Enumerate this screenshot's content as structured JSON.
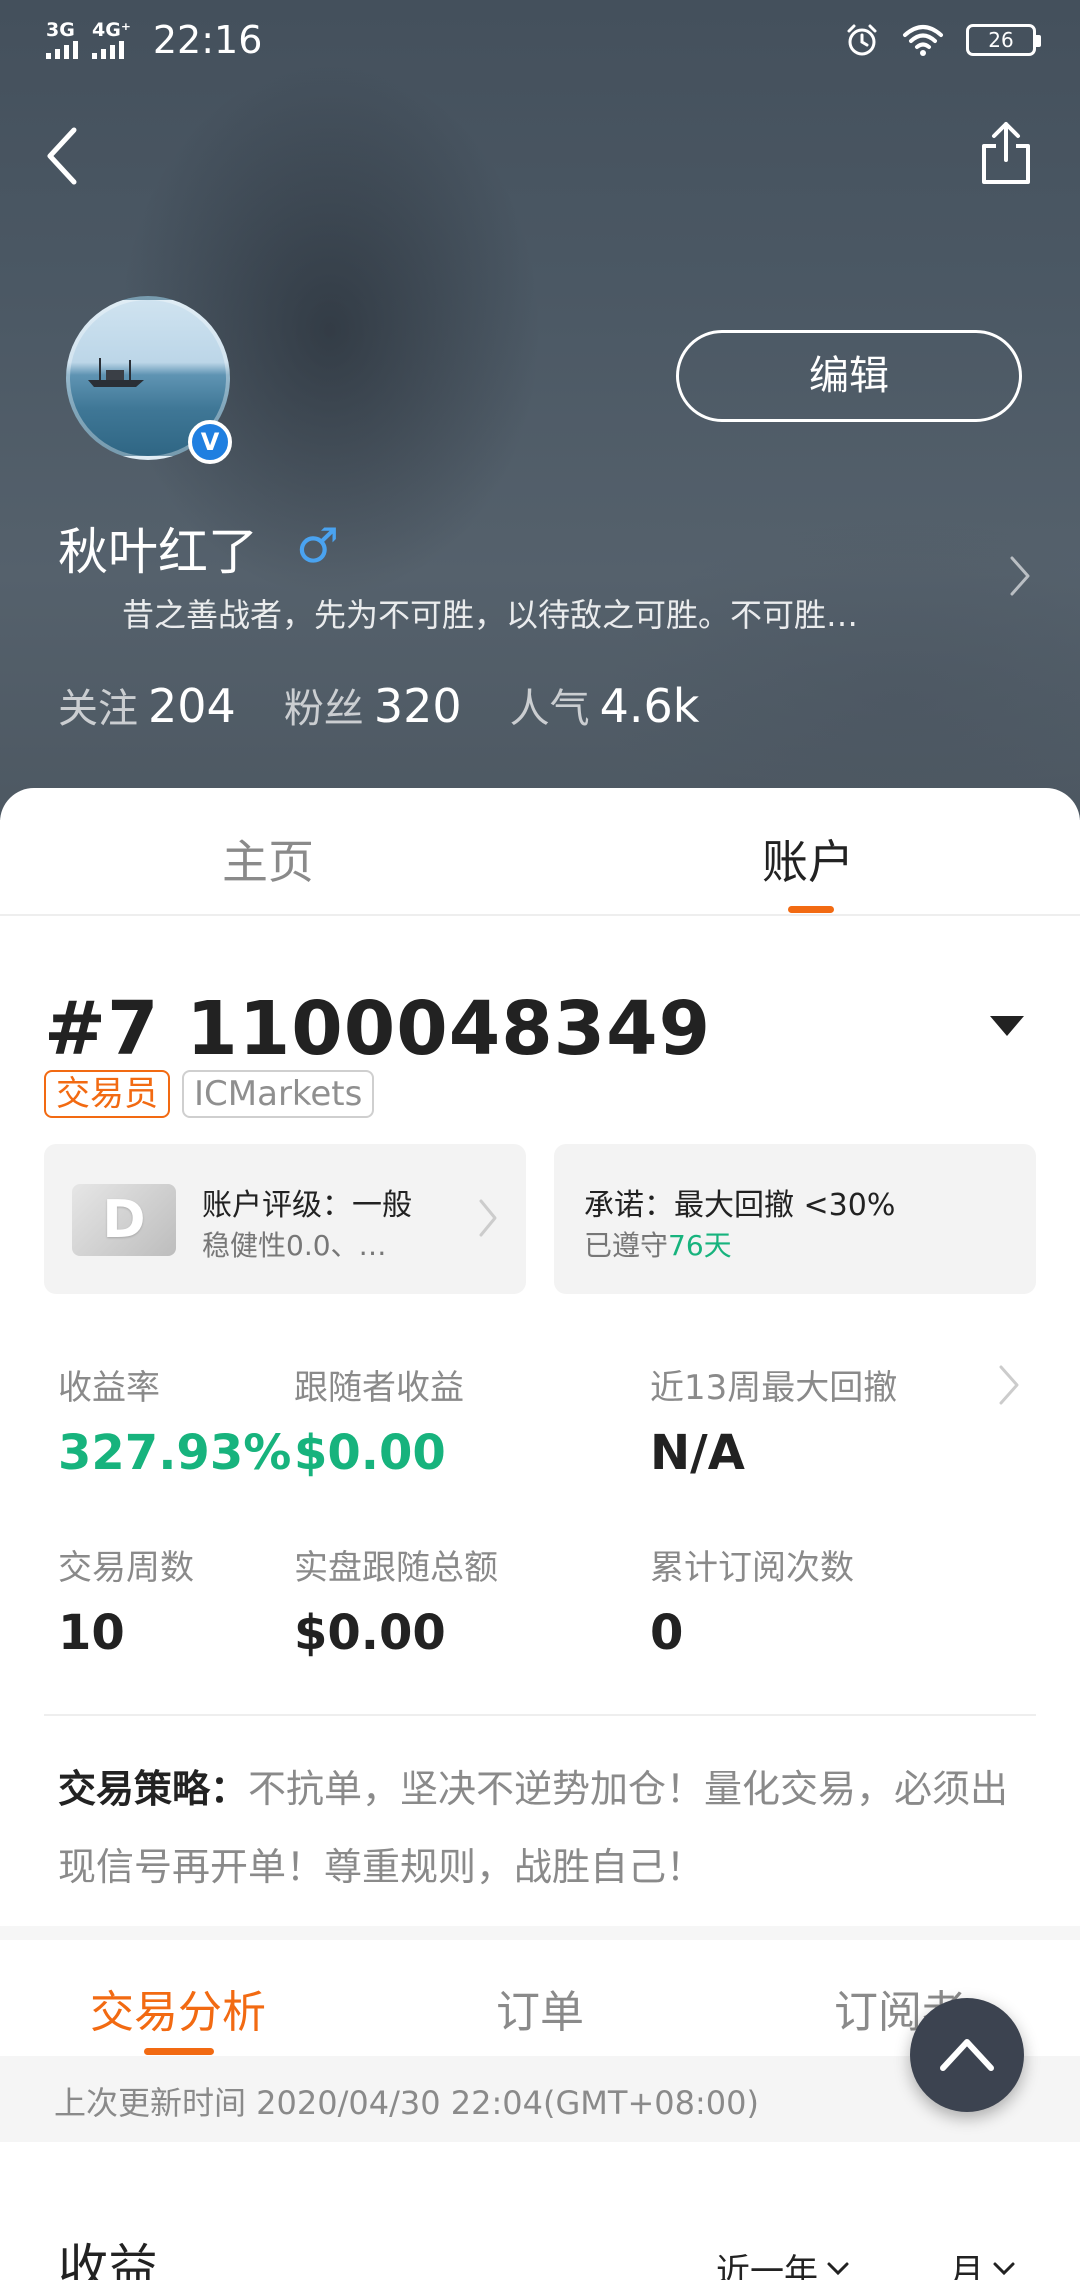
{
  "status_bar": {
    "net1": "3G",
    "net2": "4G⁺",
    "time": "22:16",
    "battery": "26"
  },
  "header": {
    "edit_label": "编辑",
    "user_name": "秋叶红了",
    "gender_symbol": "♂",
    "verify_symbol": "V",
    "bio": "昔之善战者，先为不可胜，以待敌之可胜。不可胜…",
    "stats": [
      {
        "label": "关注",
        "value": "204"
      },
      {
        "label": "粉丝",
        "value": "320"
      },
      {
        "label": "人气",
        "value": "4.6k"
      }
    ]
  },
  "tabs": {
    "home": "主页",
    "account": "账户"
  },
  "account": {
    "number": "#7 1100048349",
    "tag_role": "交易员",
    "tag_broker": "ICMarkets",
    "rating_badge": "D",
    "rating_title": "账户评级：一般",
    "rating_sub": "稳健性0.0、…",
    "promise_title": "承诺：最大回撤 <30%",
    "promise_sub_prefix": "已遵守",
    "promise_days": "76天"
  },
  "metrics": {
    "return_label": "收益率",
    "return_value": "327.93%",
    "follower_income_label": "跟随者收益",
    "follower_income_value": "$0.00",
    "max_drawdown_label": "近13周最大回撤",
    "max_drawdown_value": "N/A",
    "trade_weeks_label": "交易周数",
    "trade_weeks_value": "10",
    "real_follow_label": "实盘跟随总额",
    "real_follow_value": "$0.00",
    "subscriptions_label": "累计订阅次数",
    "subscriptions_value": "0"
  },
  "strategy": {
    "label": "交易策略：",
    "text": "不抗单，坚决不逆势加仓！量化交易，必须出现信号再开单！尊重规则，战胜自己！"
  },
  "subtabs": {
    "analysis": "交易分析",
    "orders": "订单",
    "subscribers": "订阅者"
  },
  "update": {
    "text": "上次更新时间 2020/04/30 22:04(GMT+08:00)"
  },
  "income": {
    "title": "收益",
    "filter_period": "近一年",
    "filter_unit": "月"
  },
  "colors": {
    "accent": "#f26a12",
    "positive": "#17b37d",
    "header_bg": "#4b5864"
  }
}
